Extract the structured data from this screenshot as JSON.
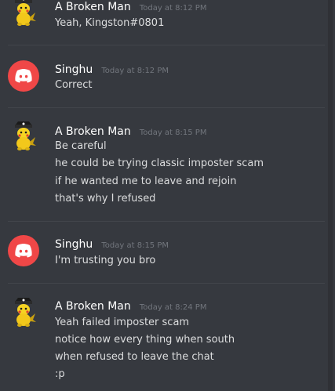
{
  "messages": [
    {
      "author": "A Broken Man",
      "timestamp": "Today at 8:12 PM",
      "avatar": "pikachu-pirate-avatar",
      "lines": [
        "Yeah, Kingston#0801"
      ]
    },
    {
      "author": "Singhu",
      "timestamp": "Today at 8:12 PM",
      "avatar": "discord-logo-avatar",
      "lines": [
        "Correct"
      ]
    },
    {
      "author": "A Broken Man",
      "timestamp": "Today at 8:15 PM",
      "avatar": "pikachu-pirate-avatar",
      "lines": [
        "Be careful",
        "he could be trying classic imposter scam",
        "if he wanted me to leave and rejoin",
        "that's why I refused"
      ]
    },
    {
      "author": "Singhu",
      "timestamp": "Today at 8:15 PM",
      "avatar": "discord-logo-avatar",
      "lines": [
        "I'm trusting you bro"
      ]
    },
    {
      "author": "A Broken Man",
      "timestamp": "Today at 8:24 PM",
      "avatar": "pikachu-pirate-avatar",
      "lines": [
        "Yeah failed imposter scam",
        "notice how every thing when south",
        "when refused to leave the chat",
        ":p"
      ]
    }
  ],
  "colors": {
    "background": "#36393f",
    "username": "#ffffff",
    "text": "#dcddde",
    "timestamp": "#72767d",
    "discord_red": "#f04747"
  }
}
